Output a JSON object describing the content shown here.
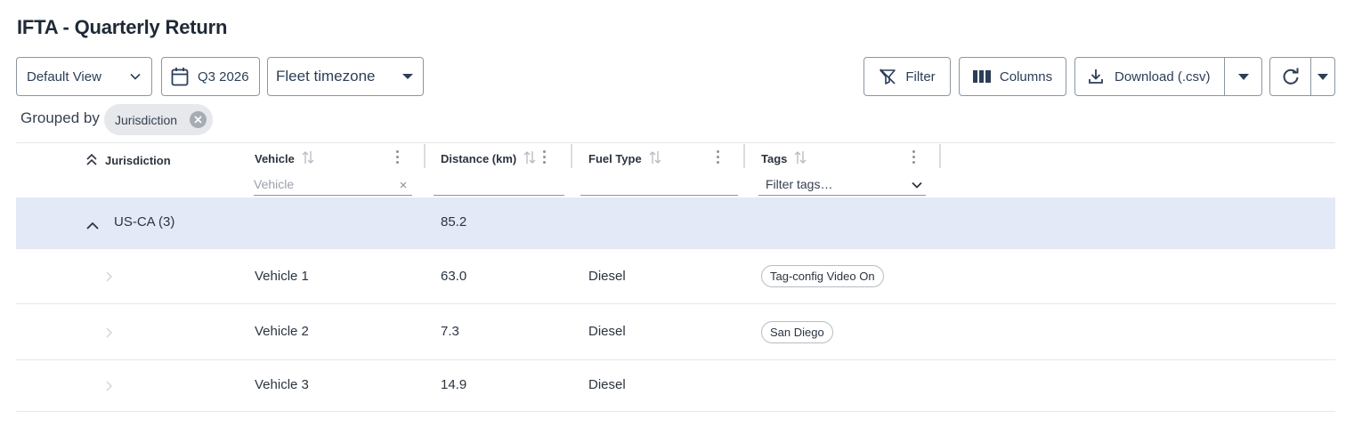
{
  "page": {
    "title": "IFTA - Quarterly Return"
  },
  "toolbar": {
    "view_select": {
      "value": "Default View"
    },
    "date_range": {
      "label": "Q3 2026"
    },
    "timezone_select": {
      "value": "Fleet timezone"
    },
    "filter_label": "Filter",
    "columns_label": "Columns",
    "download_label": "Download (.csv)"
  },
  "grouping": {
    "label": "Grouped by",
    "chips": [
      {
        "label": "Jurisdiction"
      }
    ]
  },
  "table": {
    "columns": [
      {
        "key": "jurisdiction",
        "label": "Jurisdiction"
      },
      {
        "key": "vehicle",
        "label": "Vehicle",
        "filter_placeholder": "Vehicle"
      },
      {
        "key": "distance",
        "label": "Distance (km)"
      },
      {
        "key": "fuel_type",
        "label": "Fuel Type"
      },
      {
        "key": "tags",
        "label": "Tags",
        "filter_placeholder": "Filter tags…"
      }
    ],
    "groups": [
      {
        "label": "US-CA (3)",
        "distance_total": "85.2",
        "expanded": true,
        "rows": [
          {
            "vehicle": "Vehicle 1",
            "distance": "63.0",
            "fuel_type": "Diesel",
            "tags": [
              "Tag-config Video On"
            ]
          },
          {
            "vehicle": "Vehicle 2",
            "distance": "7.3",
            "fuel_type": "Diesel",
            "tags": [
              "San Diego"
            ]
          },
          {
            "vehicle": "Vehicle 3",
            "distance": "14.9",
            "fuel_type": "Diesel",
            "tags": []
          }
        ]
      }
    ]
  },
  "colors": {
    "text": "#1f2937",
    "border": "#8a96a3",
    "group_row_bg": "#e3e9f7",
    "chip_bg": "#e6e8eb",
    "row_divider": "#e5e7eb"
  }
}
